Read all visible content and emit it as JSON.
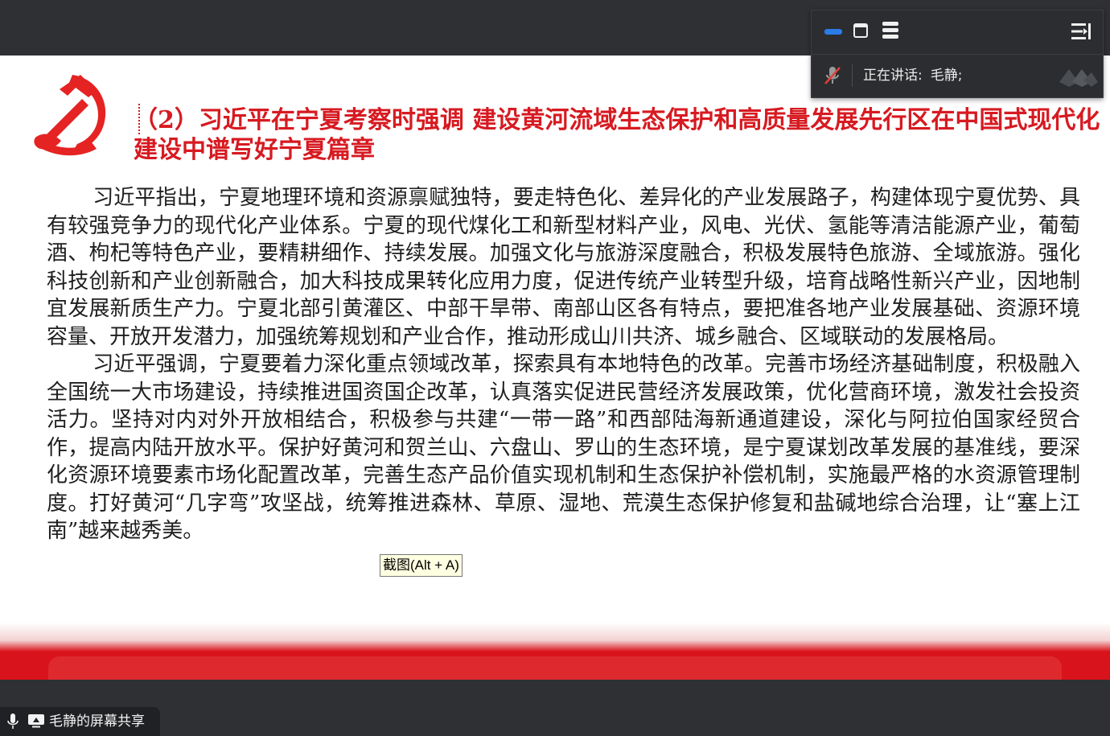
{
  "slide": {
    "title": "（2）习近平在宁夏考察时强调 建设黄河流域生态保护和高质量发展先行区在中国式现代化建设中谱写好宁夏篇章",
    "paragraphs": [
      "习近平指出，宁夏地理环境和资源禀赋独特，要走特色化、差异化的产业发展路子，构建体现宁夏优势、具有较强竞争力的现代化产业体系。宁夏的现代煤化工和新型材料产业，风电、光伏、氢能等清洁能源产业，葡萄酒、枸杞等特色产业，要精耕细作、持续发展。加强文化与旅游深度融合，积极发展特色旅游、全域旅游。强化科技创新和产业创新融合，加大科技成果转化应用力度，促进传统产业转型升级，培育战略性新兴产业，因地制宜发展新质生产力。宁夏北部引黄灌区、中部干旱带、南部山区各有特点，要把准各地产业发展基础、资源环境容量、开放开发潜力，加强统筹规划和产业合作，推动形成山川共济、城乡融合、区域联动的发展格局。",
      "习近平强调，宁夏要着力深化重点领域改革，探索具有本地特色的改革。完善市场经济基础制度，积极融入全国统一大市场建设，持续推进国资国企改革，认真落实促进民营经济发展政策，优化营商环境，激发社会投资活力。坚持对内对外开放相结合，积极参与共建“一带一路”和西部陆海新通道建设，深化与阿拉伯国家经贸合作，提高内陆开放水平。保护好黄河和贺兰山、六盘山、罗山的生态环境，是宁夏谋划改革发展的基准线，要深化资源环境要素市场化配置改革，完善生态产品价值实现机制和生态保护补偿机制，实施最严格的水资源管理制度。打好黄河“几字弯”攻坚战，统筹推进森林、草原、湿地、荒漠生态保护修复和盐碱地综合治理，让“塞上江南”越来越秀美。"
    ]
  },
  "tooltip": {
    "text": "截图(Alt + A)"
  },
  "meeting_panel": {
    "speaking_label": "正在讲话:",
    "speaker": "毛静;",
    "icons": [
      "minimize-icon",
      "window-icon",
      "list-icon",
      "collapse-icon",
      "mic-off-icon"
    ],
    "accent": "#2b7ce9"
  },
  "share_bar": {
    "label": "毛静的屏幕共享",
    "icons": [
      "microphone-icon",
      "screen-share-icon"
    ]
  },
  "colors": {
    "title_red": "#d71a21",
    "banner_red": "#d9131b",
    "background_dark": "#2e3033"
  }
}
